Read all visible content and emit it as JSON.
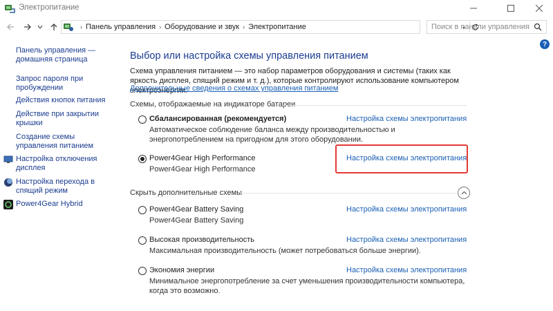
{
  "window": {
    "title": "Электропитание"
  },
  "address": {
    "breadcrumbs": [
      "Панель управления",
      "Оборудование и звук",
      "Электропитание"
    ],
    "search_placeholder": "Поиск в панели управления"
  },
  "sidebar": {
    "home_label": "Панель управления — домашняя страница",
    "items": [
      {
        "label": "Запрос пароля при пробуждении",
        "icon": "none"
      },
      {
        "label": "Действия кнопок питания",
        "icon": "none"
      },
      {
        "label": "Действие при закрытии крышки",
        "icon": "none"
      },
      {
        "label": "Создание схемы управления питанием",
        "icon": "none"
      },
      {
        "label": "Настройка отключения дисплея",
        "icon": "monitor-icon"
      },
      {
        "label": "Настройка перехода в спящий режим",
        "icon": "sleep-moon-icon"
      },
      {
        "label": "Power4Gear Hybrid",
        "icon": "power4gear-icon"
      }
    ]
  },
  "main": {
    "title": "Выбор или настройка схемы управления питанием",
    "description": "Схема управления питанием — это набор параметров оборудования и системы (таких как яркость дисплея, спящий режим и т. д.), которые контролируют использование компьютером электроэнергии.",
    "more_link": "Дополнительные сведения о схемах управления питанием",
    "section_battery": "Схемы, отображаемые на индикаторе батареи",
    "section_hidden": "Скрыть дополнительные схемы",
    "settings_link": "Настройка схемы электропитания",
    "plans": [
      {
        "name": "Сбалансированная (рекомендуется)",
        "description": "Автоматическое соблюдение баланса между производительностью и энергопотреблением на пригодном для этого оборудовании.",
        "selected": false,
        "bold": true
      },
      {
        "name": "Power4Gear High Performance",
        "description": "Power4Gear High Performance",
        "selected": true,
        "bold": false
      }
    ],
    "hidden_plans": [
      {
        "name": "Power4Gear Battery Saving",
        "description": "Power4Gear Battery Saving",
        "selected": false
      },
      {
        "name": "Высокая производительность",
        "description": "Максимальная производительность (может потребоваться больше энергии).",
        "selected": false
      },
      {
        "name": "Экономия энергии",
        "description": "Минимальное энергопотребление за счет уменьшения производительности компьютера, когда это возможно.",
        "selected": false
      }
    ]
  },
  "colors": {
    "link": "#1a5fb4",
    "heading": "#1a3c8f",
    "highlight": "#e53935"
  }
}
